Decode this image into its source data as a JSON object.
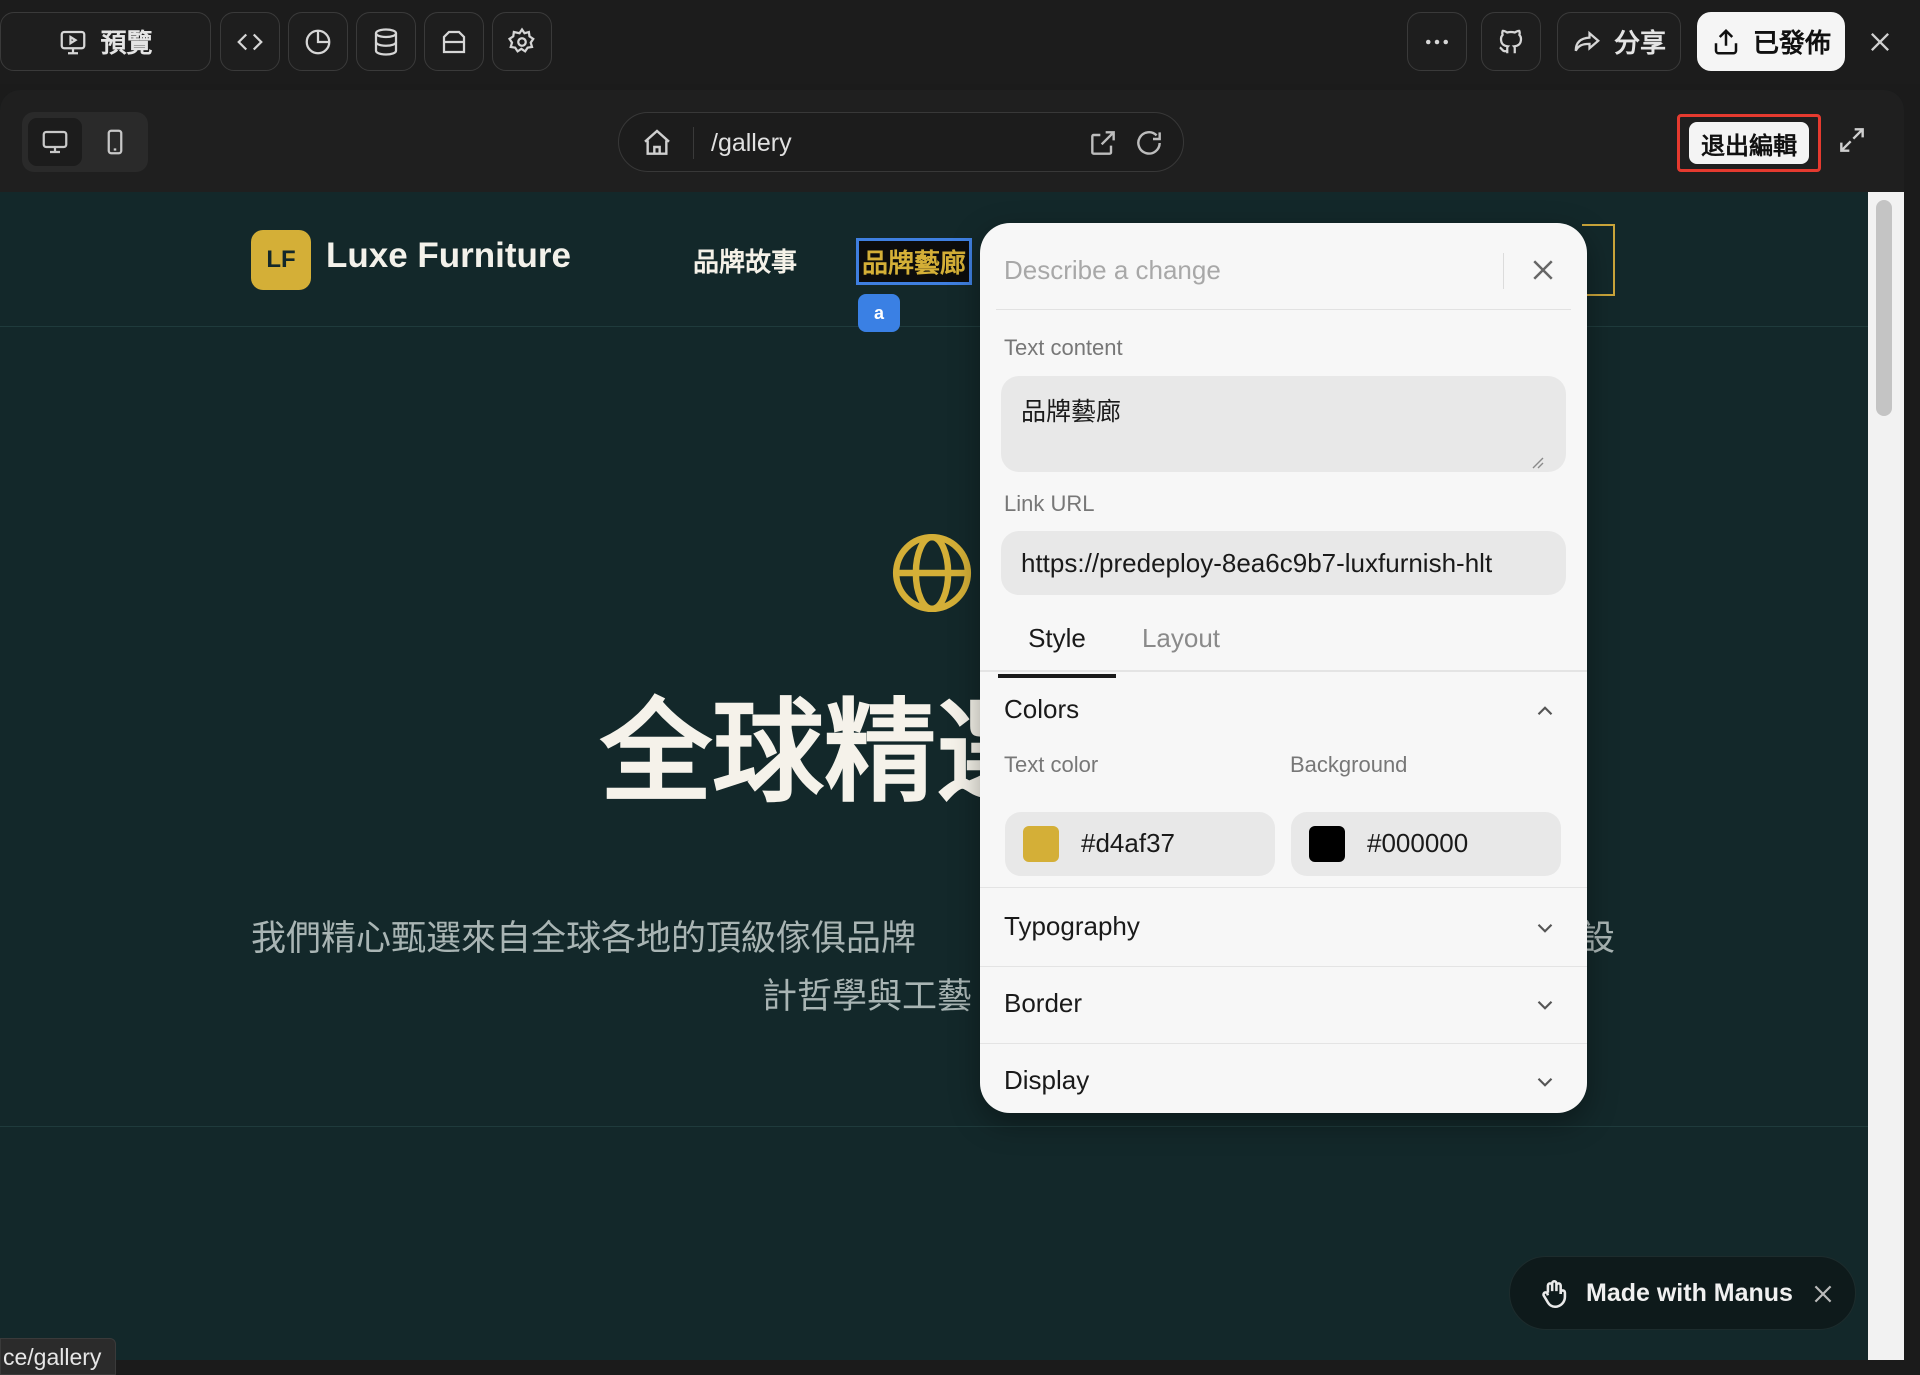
{
  "toolbar": {
    "preview_label": "預覽",
    "share_label": "分享",
    "published_label": "已發佈"
  },
  "browser": {
    "path": "/gallery",
    "exit_edit_label": "退出編輯"
  },
  "site": {
    "logo_initials": "LF",
    "brand_name": "Luxe Furniture",
    "nav": [
      "品牌故事",
      "品牌藝廊"
    ],
    "selected_tag": "a",
    "hero_title": "全球精選",
    "hero_sub_line1a": "我們精心甄選來自全球各地的頂級傢俱品牌",
    "hero_sub_line1b": "設",
    "hero_sub_line2": "計哲學與工藝"
  },
  "panel": {
    "placeholder": "Describe a change",
    "text_content_label": "Text content",
    "text_content_value": "品牌藝廊",
    "link_url_label": "Link URL",
    "link_url_value": "https://predeploy-8ea6c9b7-luxfurnish-hlt",
    "tabs": [
      "Style",
      "Layout"
    ],
    "sections": {
      "colors": "Colors",
      "text_color_label": "Text color",
      "text_color_value": "#d4af37",
      "background_label": "Background",
      "background_value": "#000000",
      "typography": "Typography",
      "border": "Border",
      "display": "Display"
    }
  },
  "badge": {
    "made_with": "Made with Manus"
  },
  "status_url": "ce/gallery",
  "colors": {
    "accent_gold": "#d4af37",
    "page_bg": "#13282a",
    "selection_blue": "#3f7fe0",
    "highlight_red": "#e53a2f"
  }
}
